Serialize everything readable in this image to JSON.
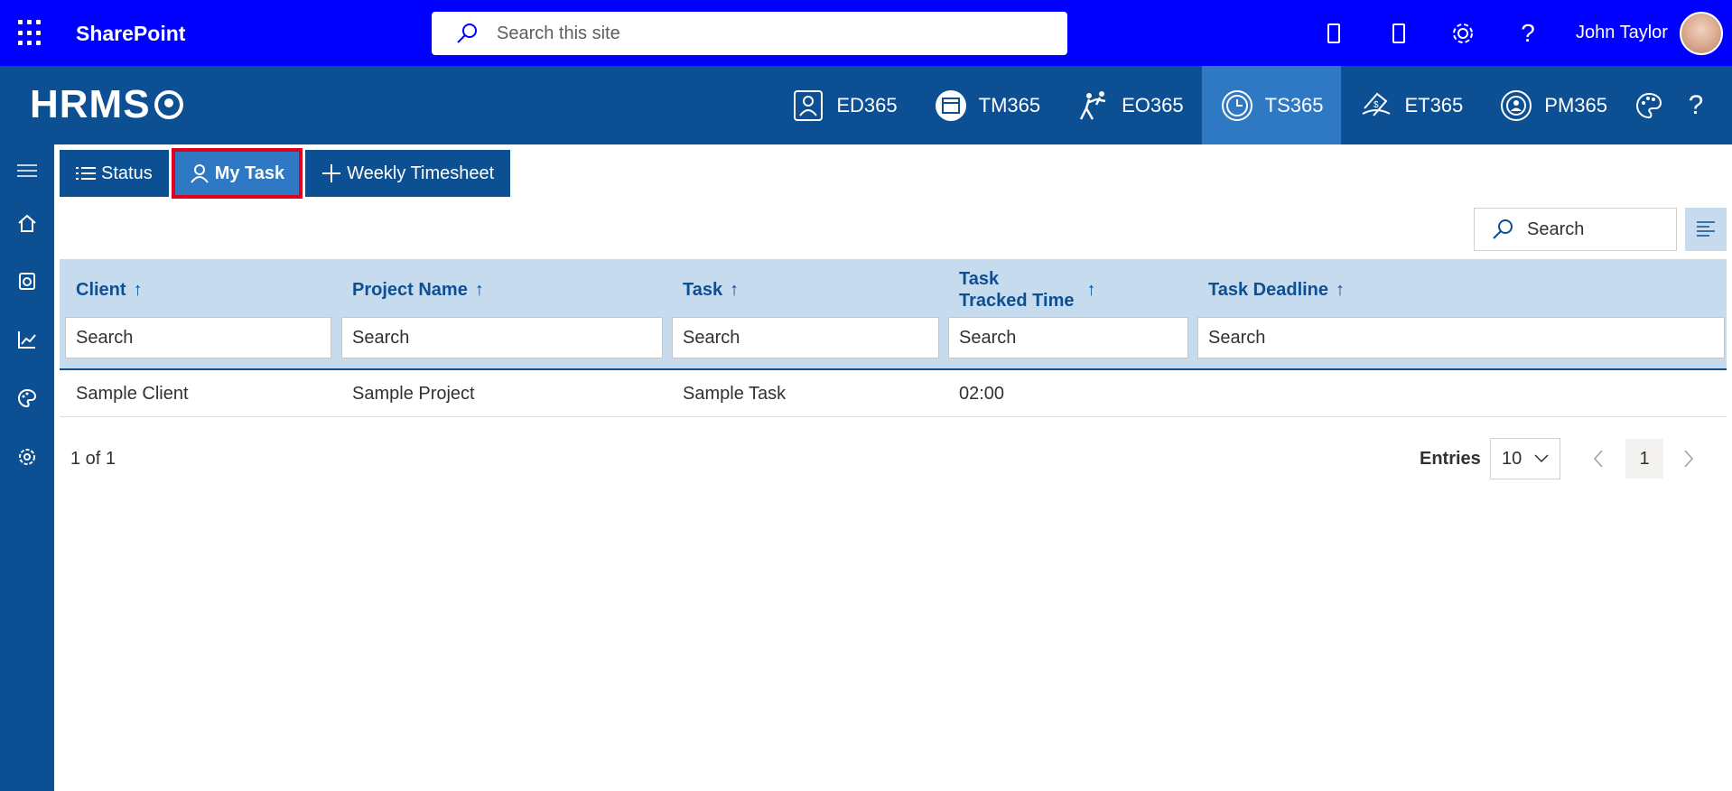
{
  "suite": {
    "app_name": "SharePoint",
    "search_placeholder": "Search this site",
    "user_name": "John Taylor",
    "icons": [
      "waffle-icon",
      "mobile-icon",
      "mobile-icon",
      "gear-icon",
      "help-icon"
    ]
  },
  "hrms": {
    "logo_text": "HRMS",
    "modules": [
      {
        "label": "ED365",
        "icon": "employee-directory-icon",
        "active": false
      },
      {
        "label": "TM365",
        "icon": "calendar-icon",
        "active": false
      },
      {
        "label": "EO365",
        "icon": "onboarding-icon",
        "active": false
      },
      {
        "label": "TS365",
        "icon": "clock-icon",
        "active": true
      },
      {
        "label": "ET365",
        "icon": "expense-icon",
        "active": false
      },
      {
        "label": "PM365",
        "icon": "performance-icon",
        "active": false
      }
    ]
  },
  "rail": [
    "menu-icon",
    "home-icon",
    "timesheet-icon",
    "chart-icon",
    "palette-icon",
    "settings-icon"
  ],
  "actions": {
    "status": "Status",
    "my_task": "My Task",
    "weekly": "Weekly Timesheet"
  },
  "grid": {
    "search_placeholder": "Search",
    "columns": [
      {
        "label": "Client",
        "arrow": "↑"
      },
      {
        "label": "Project Name",
        "arrow": "↑"
      },
      {
        "label": "Task",
        "arrow": "↑"
      },
      {
        "label_line1": "Task",
        "label_line2": "Tracked Time",
        "arrow": "↑"
      },
      {
        "label": "Task Deadline",
        "arrow": "↑"
      }
    ],
    "filter_placeholder": "Search",
    "rows": [
      {
        "client": "Sample Client",
        "project": "Sample Project",
        "task": "Sample Task",
        "tracked": "02:00",
        "deadline": ""
      }
    ]
  },
  "footer": {
    "count": "1 of 1",
    "entries_label": "Entries",
    "entries_value": "10",
    "page": "1"
  }
}
